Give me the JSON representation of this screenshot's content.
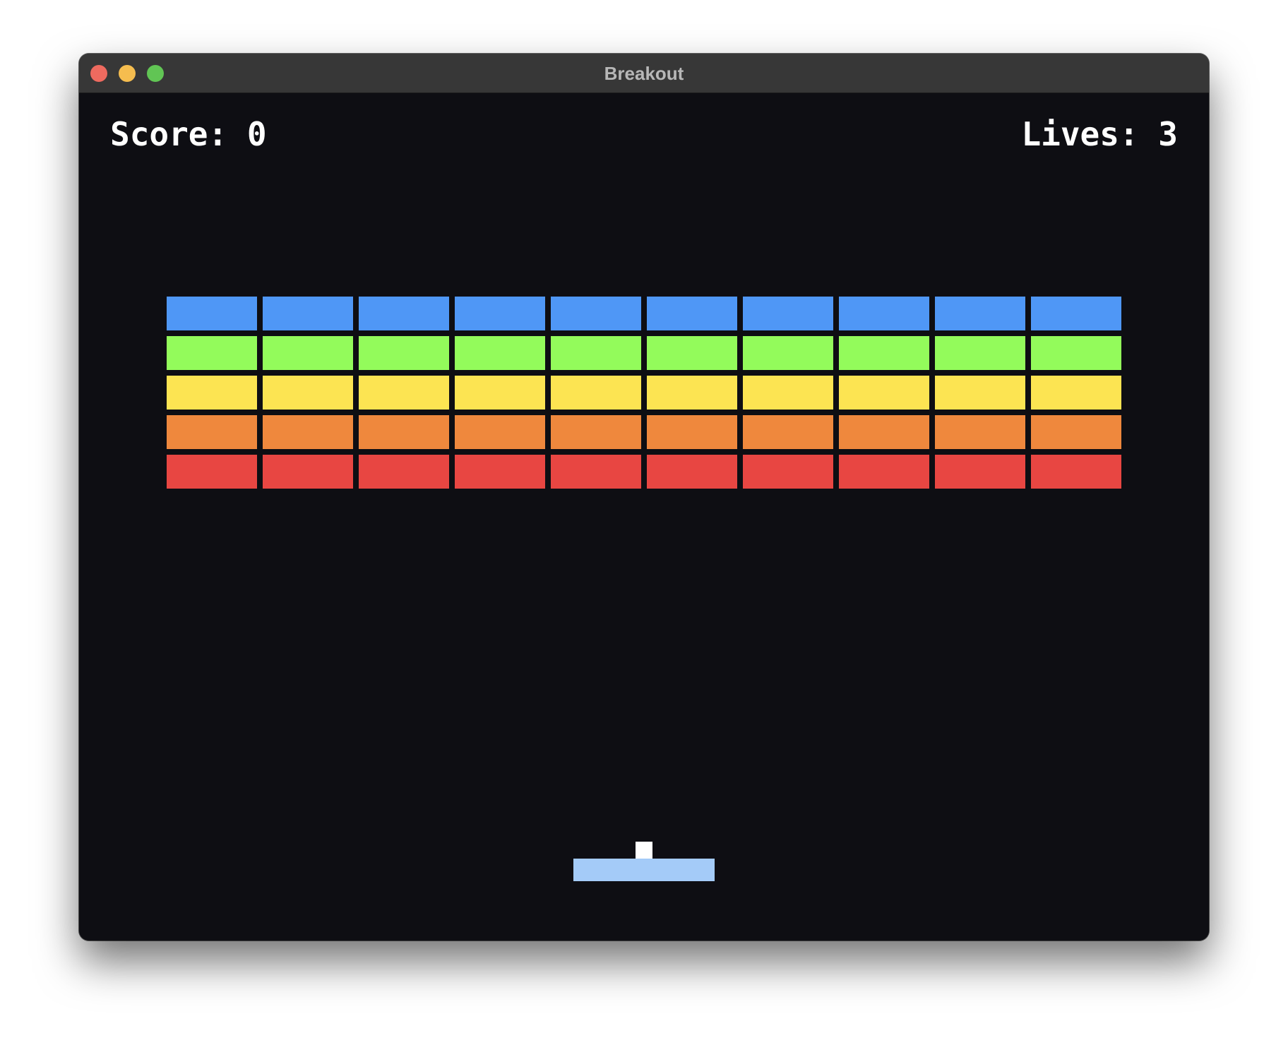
{
  "window": {
    "title": "Breakout"
  },
  "hud": {
    "score": "Score: 0",
    "lives": "Lives: 3"
  },
  "bricks": {
    "columns": 10,
    "rows": [
      {
        "color": "#4f97f6"
      },
      {
        "color": "#93fb5b"
      },
      {
        "color": "#fce452"
      },
      {
        "color": "#ef883d"
      },
      {
        "color": "#e84642"
      }
    ]
  },
  "colors": {
    "background": "#0e0e13",
    "paddle": "#a4cbf8",
    "ball": "#ffffff"
  }
}
